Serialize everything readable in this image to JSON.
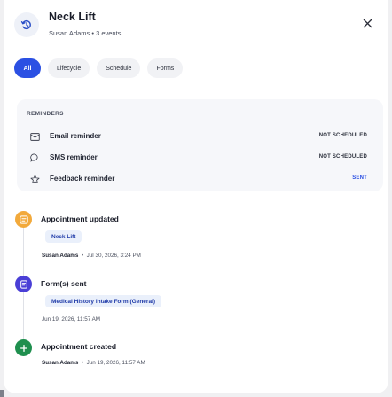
{
  "header": {
    "title": "Neck Lift",
    "subtitle": "Susan Adams • 3 events"
  },
  "filters": [
    {
      "label": "All",
      "active": true
    },
    {
      "label": "Lifecycle",
      "active": false
    },
    {
      "label": "Schedule",
      "active": false
    },
    {
      "label": "Forms",
      "active": false
    }
  ],
  "reminders": {
    "heading": "REMINDERS",
    "items": [
      {
        "label": "Email reminder",
        "status": "NOT SCHEDULED",
        "icon": "mail-icon"
      },
      {
        "label": "SMS reminder",
        "status": "NOT SCHEDULED",
        "icon": "chat-bubble-icon"
      },
      {
        "label": "Feedback reminder",
        "status": "SENT",
        "icon": "star-icon"
      }
    ]
  },
  "timeline": [
    {
      "title": "Appointment updated",
      "tag": "Neck Lift",
      "author": "Susan Adams",
      "separator": "•",
      "time": "Jul 30, 2026, 3:24 PM",
      "color": "#f2a93b",
      "icon": "edit-icon"
    },
    {
      "title": "Form(s) sent",
      "tag": "Medical History Intake Form (General)",
      "author": "",
      "separator": "",
      "time": "Jun 19, 2026, 11:57 AM",
      "color": "#4a3fd6",
      "icon": "form-icon"
    },
    {
      "title": "Appointment created",
      "tag": "",
      "author": "Susan Adams",
      "separator": "•",
      "time": "Jun 19, 2026, 11:57 AM",
      "color": "#1f8f4e",
      "icon": "plus-icon"
    }
  ],
  "colors": {
    "accent": "#2b50e3",
    "sent": "#2b50e3"
  }
}
